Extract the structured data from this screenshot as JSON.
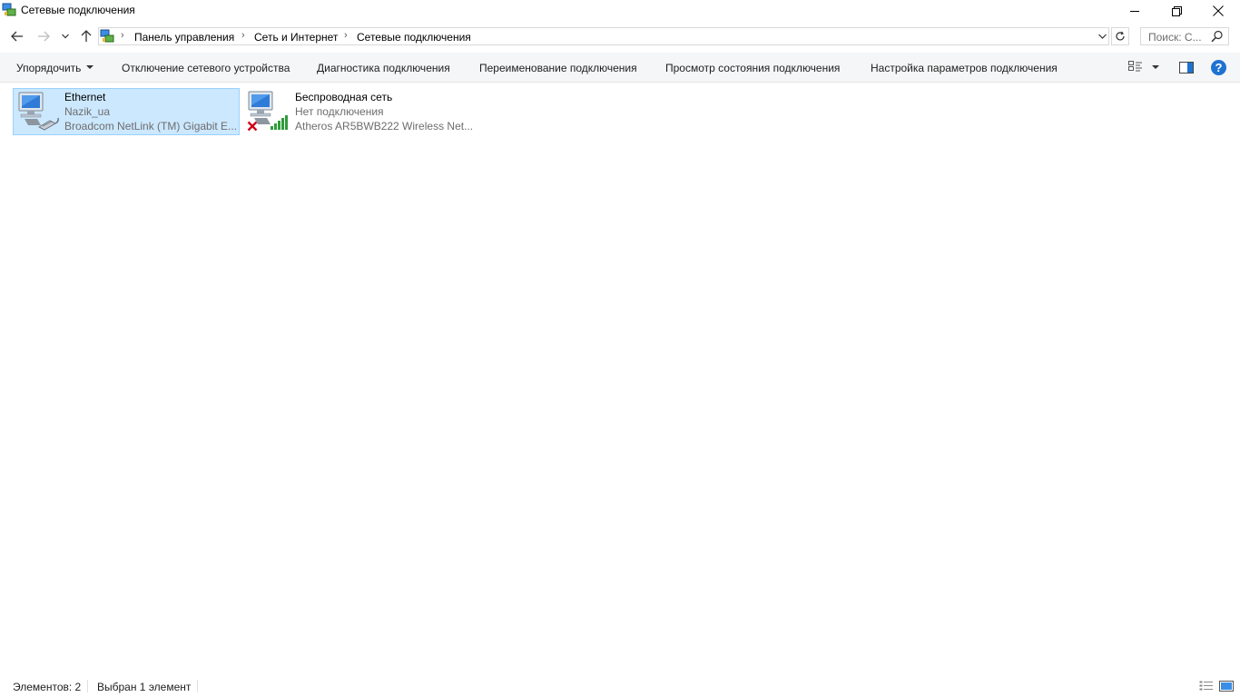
{
  "window": {
    "title": "Сетевые подключения",
    "icons": {
      "app": "network-connections-icon",
      "minimize": "minimize-icon",
      "maximize": "restore-icon",
      "close": "close-icon"
    }
  },
  "address": {
    "breadcrumbs": [
      "Панель управления",
      "Сеть и Интернет",
      "Сетевые подключения"
    ],
    "separator": "›",
    "search_placeholder": "Поиск: С..."
  },
  "commands": {
    "organize": "Упорядочить",
    "disable_device": "Отключение сетевого устройства",
    "diagnose": "Диагностика подключения",
    "rename": "Переименование подключения",
    "view_status": "Просмотр состояния подключения",
    "change_settings": "Настройка параметров подключения",
    "help": "?"
  },
  "connections": [
    {
      "name": "Ethernet",
      "status": "Nazik_ua",
      "adapter": "Broadcom NetLink (TM) Gigabit E...",
      "icon": "ethernet-adapter-icon",
      "selected": true
    },
    {
      "name": "Беспроводная сеть",
      "status": "Нет подключения",
      "adapter": "Atheros AR5BWB222 Wireless Net...",
      "icon": "wifi-adapter-icon",
      "selected": false
    }
  ],
  "statusbar": {
    "items_count": "Элементов: 2",
    "selected": "Выбран 1 элемент"
  },
  "colors": {
    "selection_bg": "#cce8ff",
    "selection_border": "#99d1ff",
    "help_blue": "#1e73d2",
    "wifi_green": "#2e9d3a",
    "error_red": "#d0021b"
  }
}
